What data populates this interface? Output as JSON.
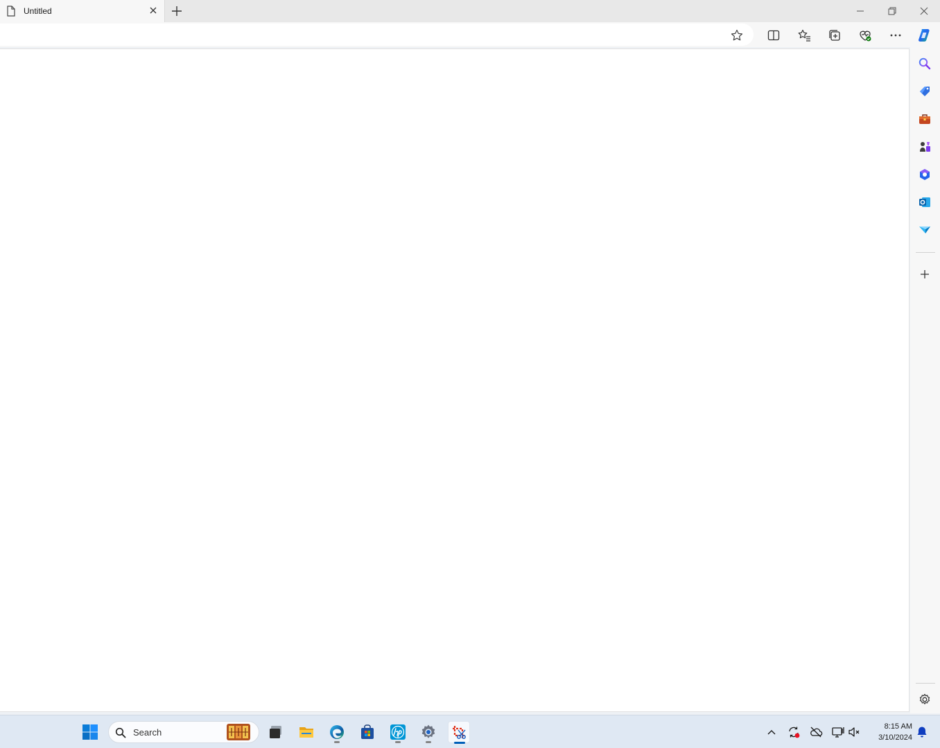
{
  "browser": {
    "tab": {
      "title": "Untitled",
      "icon": "page-icon"
    },
    "new_tab_icon": "plus-icon",
    "window_controls": [
      "minimize-icon",
      "restore-icon",
      "close-icon"
    ],
    "toolbar_icons": [
      "star-icon",
      "split-screen-icon",
      "favorites-icon",
      "collections-icon",
      "browser-essentials-icon",
      "more-icon",
      "copilot-icon"
    ],
    "sidebar_icons": [
      "search-icon",
      "shopping-icon",
      "tools-icon",
      "games-icon",
      "microsoft-365-icon",
      "outlook-icon",
      "drop-icon",
      "add-icon",
      "settings-icon"
    ]
  },
  "taskbar": {
    "search": {
      "placeholder": "Search"
    },
    "apps": [
      "task-view-icon",
      "file-explorer-icon",
      "edge-icon",
      "microsoft-store-icon",
      "hp-icon",
      "settings-icon",
      "snipping-tool-icon"
    ],
    "tray_icons": [
      "chevron-up-icon",
      "sync-icon",
      "onedrive-icon",
      "network-icon",
      "volume-muted-icon",
      "notification-bell-icon"
    ],
    "clock": {
      "time": "8:15 AM",
      "date": "3/10/2024"
    }
  },
  "colors": {
    "accent": "#005fb8",
    "notification": "#0f3dbf",
    "taskbar_bg": "#dfe8f3"
  }
}
